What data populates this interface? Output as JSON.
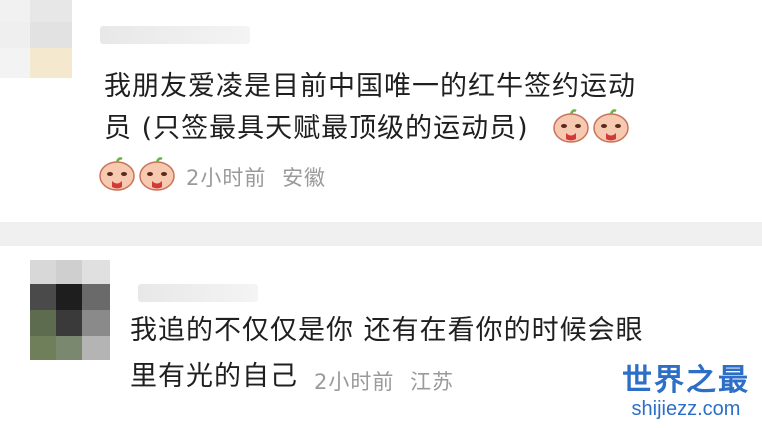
{
  "comments": [
    {
      "line1": "我朋友爱凌是目前中国唯一的红牛签约运动",
      "line2": "员 (只签最具天赋最顶级的运动员)",
      "time": "2小时前",
      "location": "安徽",
      "emoji_name": "crying-face-emoji"
    },
    {
      "line1": "我追的不仅仅是你 还有在看你的时候会眼",
      "line2": "里有光的自己",
      "time": "2小时前",
      "location": "江苏"
    }
  ],
  "watermark": {
    "title": "世界之最",
    "url": "shijiezz.com"
  },
  "colors": {
    "text": "#1f1f1f",
    "meta": "#9a9a9a",
    "divider": "#f0f0f0",
    "watermark": "#2d6fc7"
  }
}
